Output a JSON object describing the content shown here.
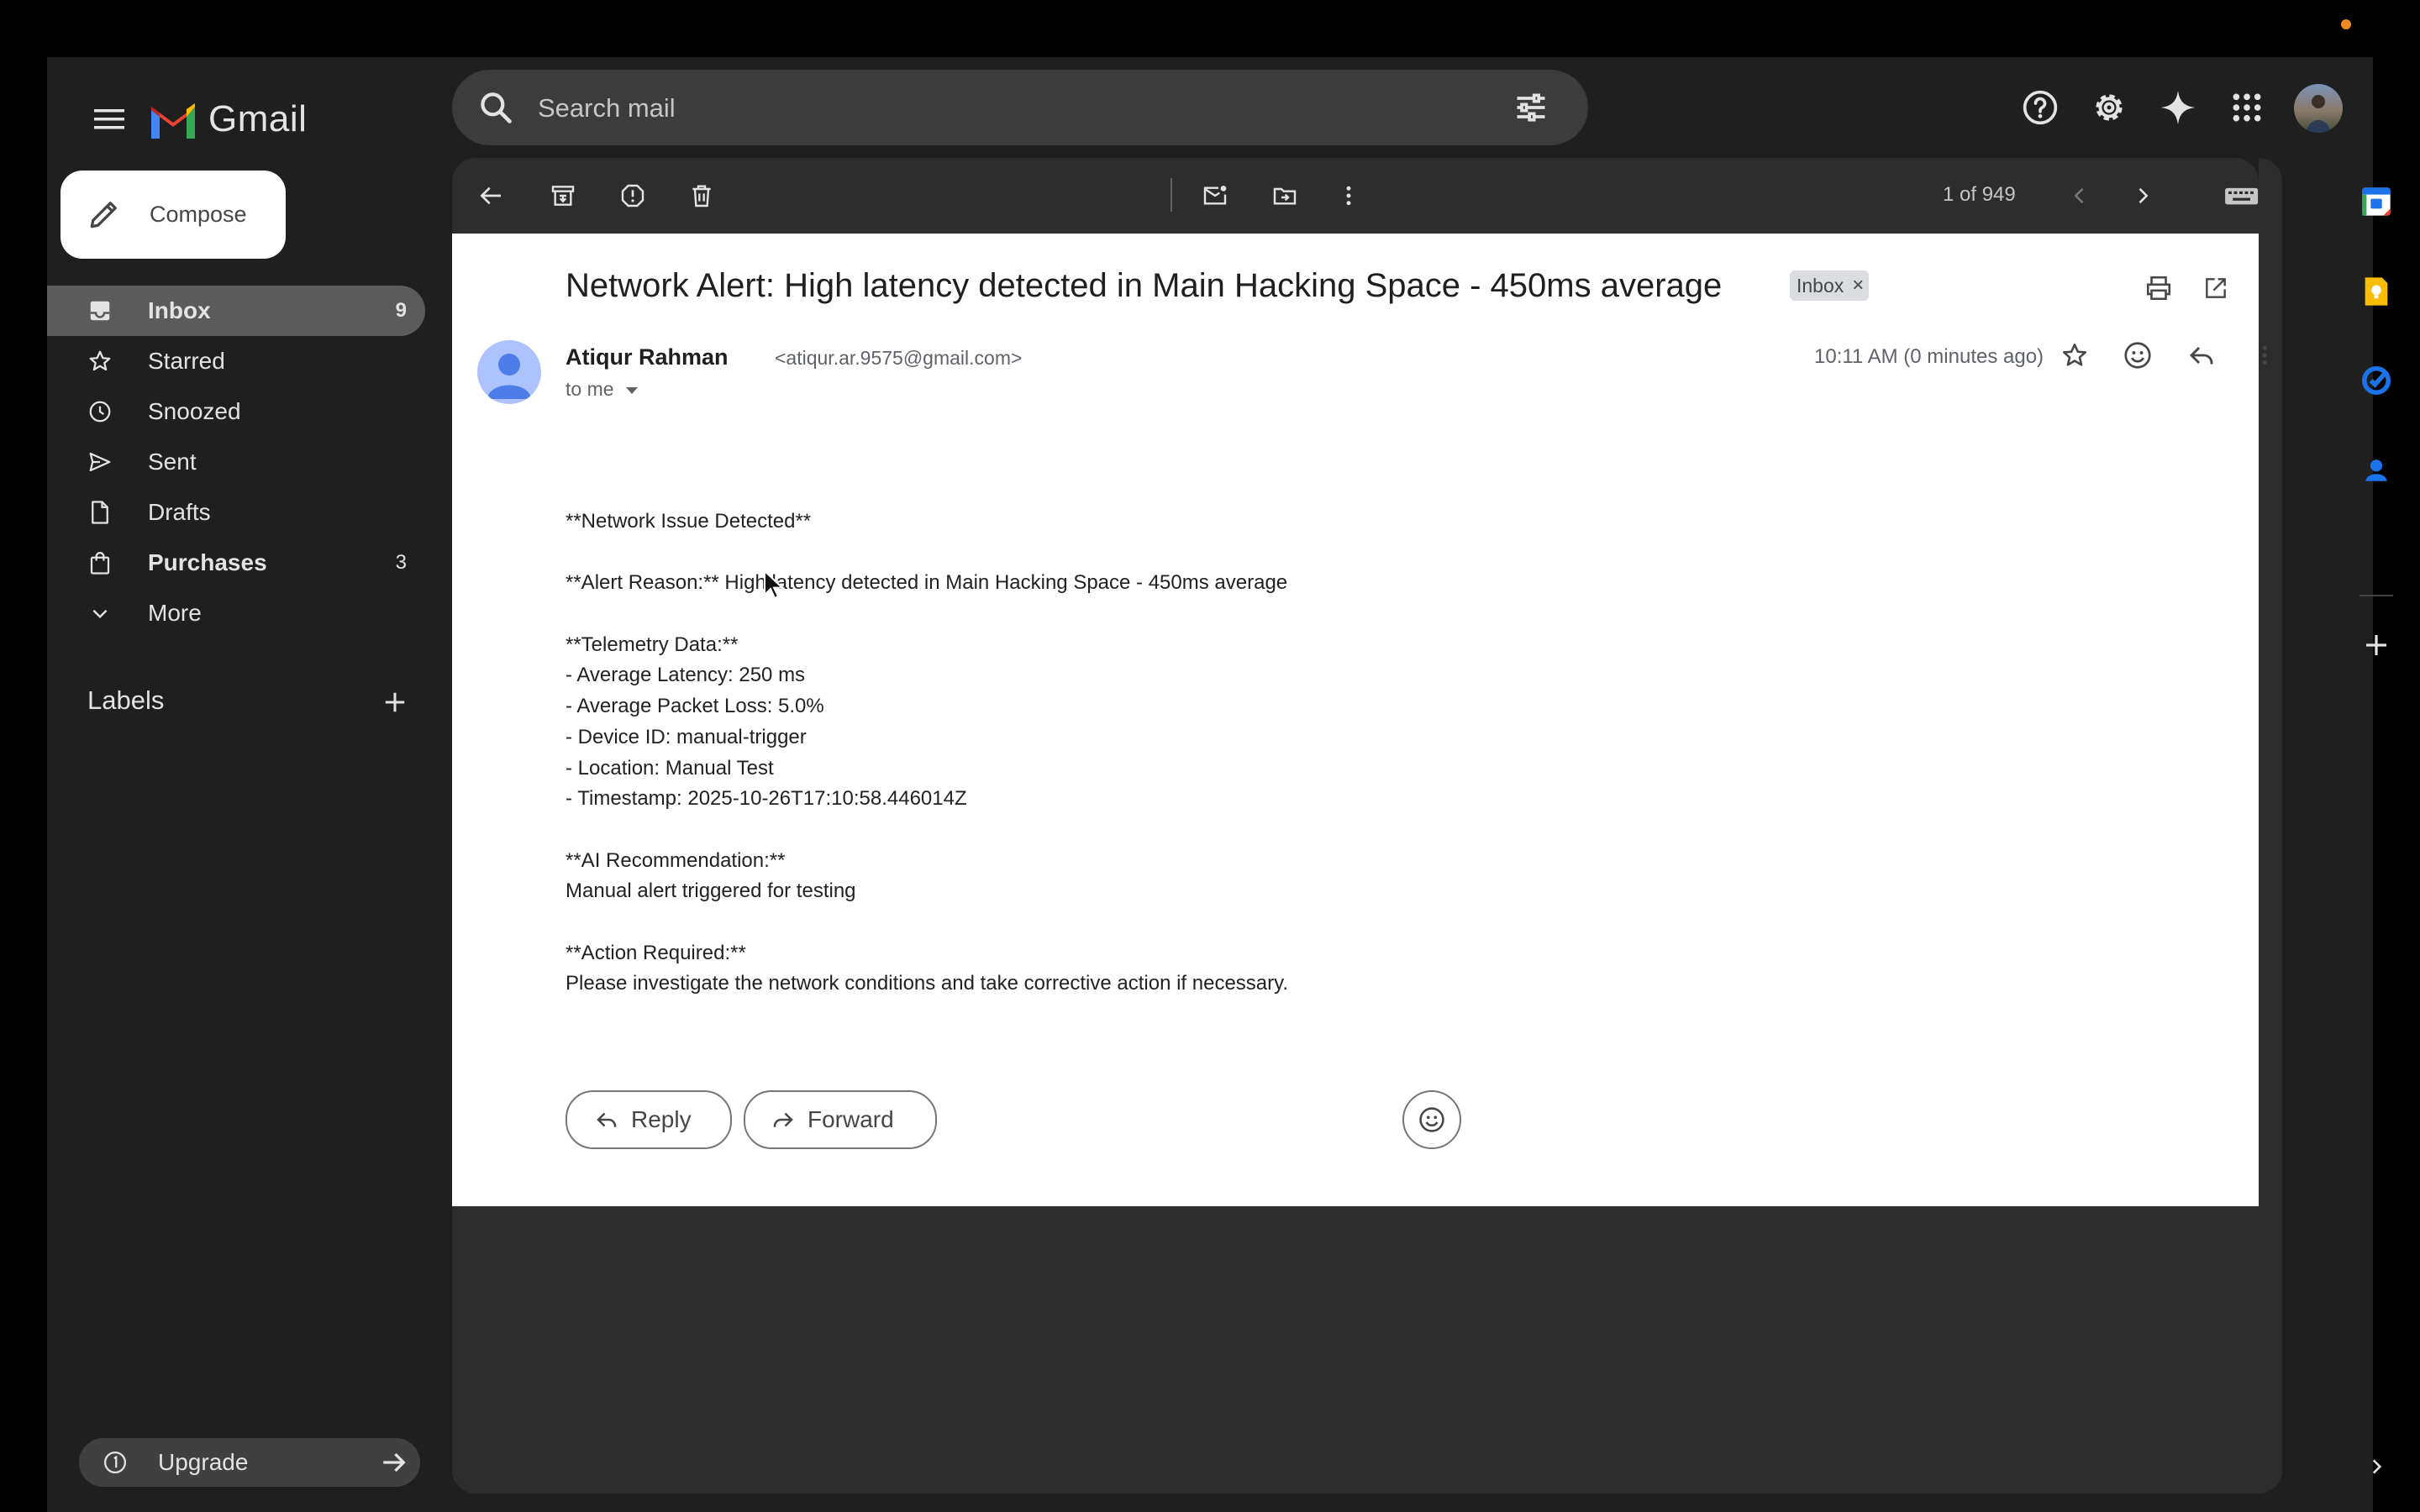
{
  "app": {
    "name": "Gmail"
  },
  "search": {
    "placeholder": "Search mail"
  },
  "compose_label": "Compose",
  "nav": {
    "items": [
      {
        "label": "Inbox",
        "count": "9",
        "active": true,
        "bold": true,
        "icon": "inbox-icon"
      },
      {
        "label": "Starred",
        "count": "",
        "icon": "star-icon"
      },
      {
        "label": "Snoozed",
        "count": "",
        "icon": "clock-icon"
      },
      {
        "label": "Sent",
        "count": "",
        "icon": "send-icon"
      },
      {
        "label": "Drafts",
        "count": "",
        "icon": "draft-icon"
      },
      {
        "label": "Purchases",
        "count": "3",
        "bold": true,
        "icon": "shopping-bag-icon"
      },
      {
        "label": "More",
        "count": "",
        "icon": "chevron-down-icon"
      }
    ]
  },
  "labels_heading": "Labels",
  "upgrade_label": "Upgrade",
  "toolbar": {
    "pager": "1 of 949"
  },
  "email": {
    "subject": "Network Alert: High latency detected in Main Hacking Space - 450ms average",
    "label_chip": "Inbox",
    "sender_name": "Atiqur Rahman",
    "sender_email": "<atiqur.ar.9575@gmail.com>",
    "to": "to me",
    "time": "10:11 AM (0 minutes ago)",
    "body": [
      "**Network Issue Detected**",
      "",
      "**Alert Reason:** High latency detected in Main Hacking Space - 450ms average",
      "",
      "**Telemetry Data:**",
      "- Average Latency: 250 ms",
      "- Average Packet Loss: 5.0%",
      "- Device ID: manual-trigger",
      "- Location: Manual Test",
      "- Timestamp: 2025-10-26T17:10:58.446014Z",
      "",
      "**AI Recommendation:**",
      "Manual alert triggered for testing",
      "",
      "**Action Required:**",
      "Please investigate the network conditions and take corrective action if necessary."
    ],
    "reply_label": "Reply",
    "forward_label": "Forward"
  },
  "colors": {
    "accent": "#0b57d0",
    "dark_bg": "#1f1f1f",
    "panel": "#2d2d2d",
    "white": "#ffffff"
  }
}
